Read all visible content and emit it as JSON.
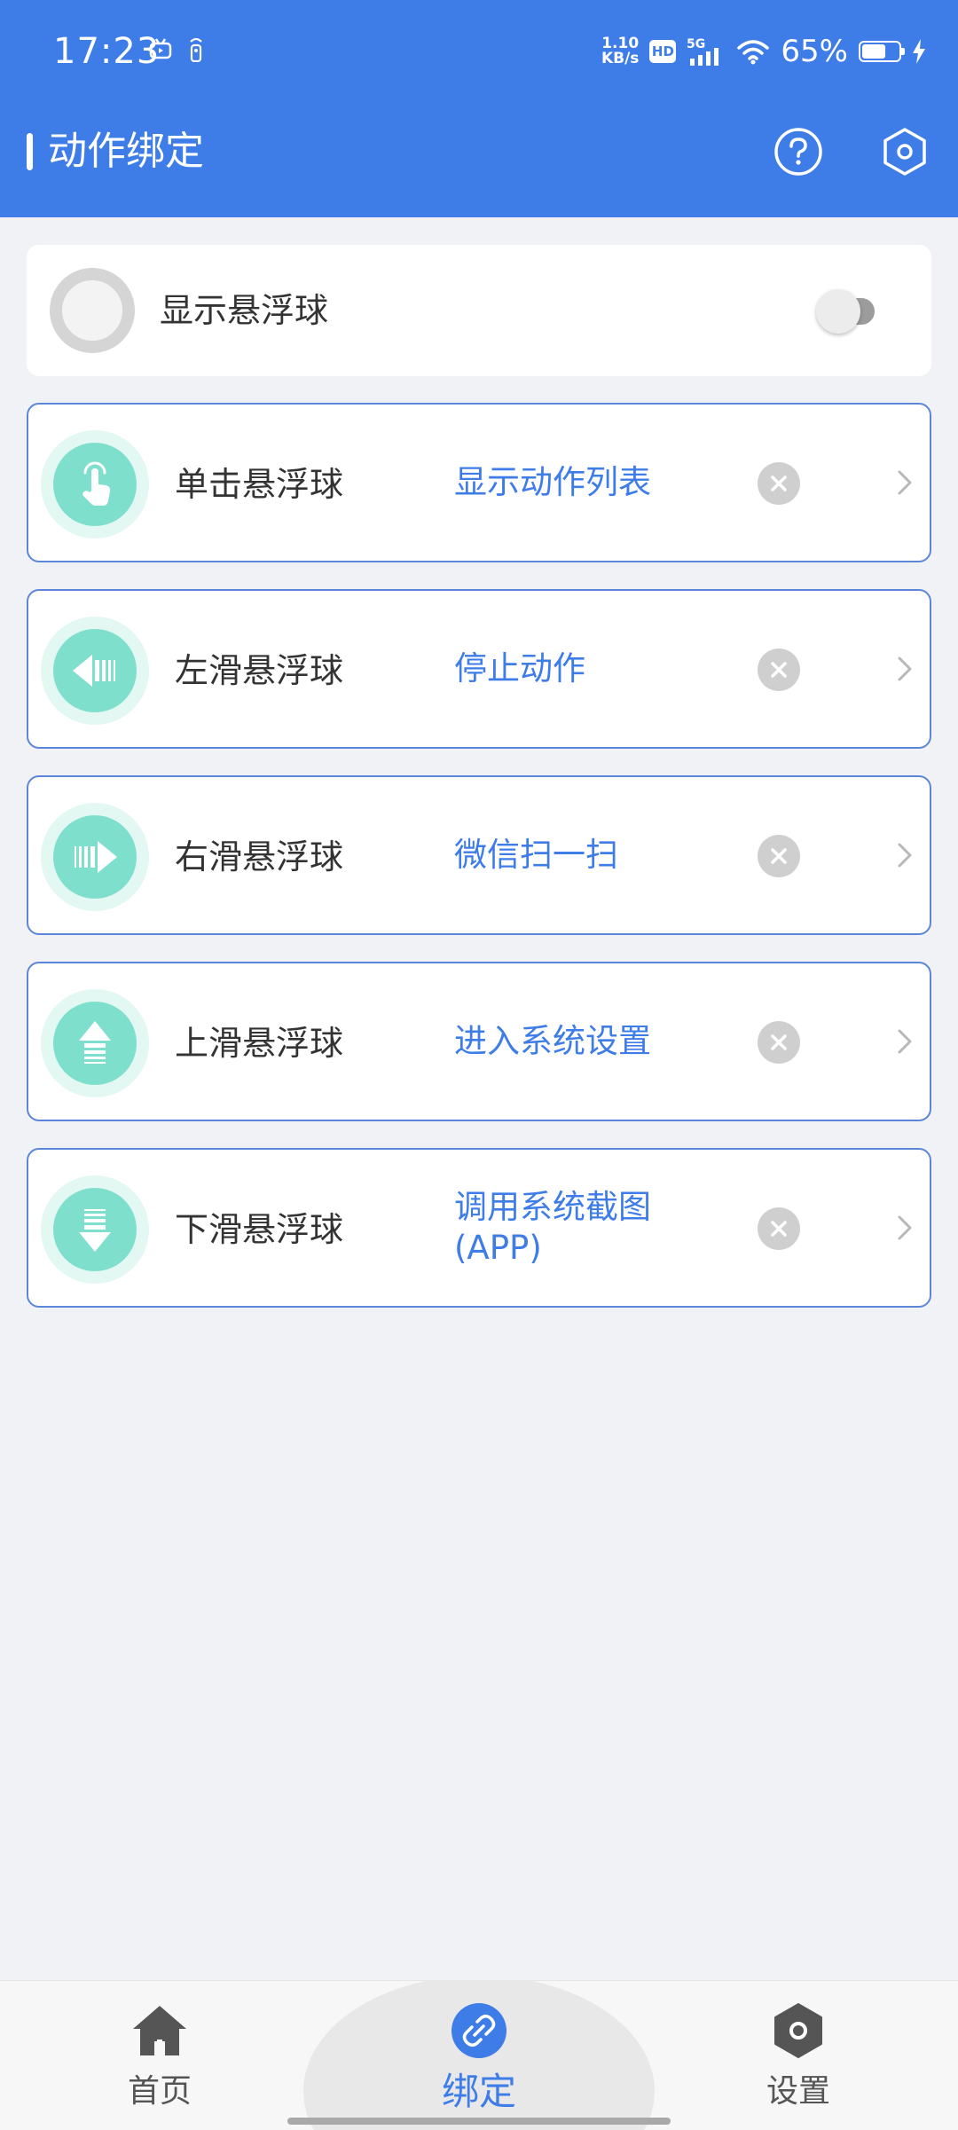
{
  "status_bar": {
    "time": "17:23",
    "net_speed_value": "1.10",
    "net_speed_unit": "KB/s",
    "hd_label": "HD",
    "network_type": "5G",
    "battery_percent": "65%",
    "battery_level": 0.65
  },
  "app_bar": {
    "title": "动作绑定",
    "help_icon": "question-icon",
    "settings_icon": "hexagon-gear-icon"
  },
  "floating_ball": {
    "label": "显示悬浮球",
    "enabled": false
  },
  "actions": [
    {
      "name": "单击悬浮球",
      "value": "显示动作列表",
      "icon": "tap-hand-icon"
    },
    {
      "name": "左滑悬浮球",
      "value": "停止动作",
      "icon": "arrow-left-icon"
    },
    {
      "name": "右滑悬浮球",
      "value": "微信扫一扫",
      "icon": "arrow-right-icon"
    },
    {
      "name": "上滑悬浮球",
      "value": "进入系统设置",
      "icon": "arrow-up-icon"
    },
    {
      "name": "下滑悬浮球",
      "value": "调用系统截图(APP)",
      "icon": "arrow-down-icon"
    }
  ],
  "bottom_nav": {
    "items": [
      {
        "label": "首页",
        "icon": "home-icon",
        "active": false
      },
      {
        "label": "绑定",
        "icon": "link-icon",
        "active": true
      },
      {
        "label": "设置",
        "icon": "settings-icon",
        "active": false
      }
    ]
  },
  "colors": {
    "primary": "#3e7ce8",
    "action_icon_bg": "#7fdfcd",
    "page_bg": "#f1f2f5"
  }
}
